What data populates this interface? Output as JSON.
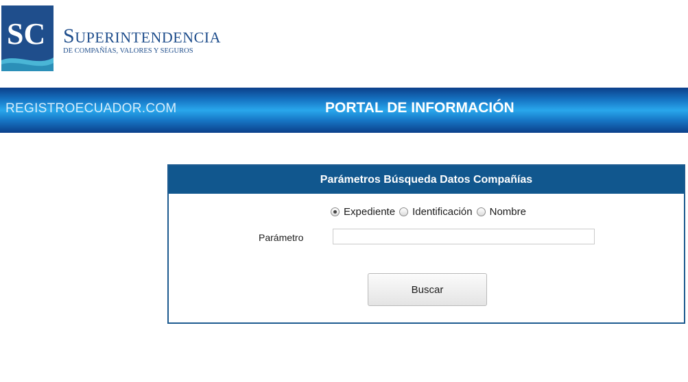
{
  "header": {
    "logo_mark": "SC",
    "logo_title_first": "S",
    "logo_title_rest": "UPERINTENDENCIA",
    "logo_subtitle": "DE COMPAÑÍAS, VALORES Y SEGUROS"
  },
  "banner": {
    "site_name": "REGISTROECUADOR.COM",
    "title": "PORTAL DE INFORMACIÓN"
  },
  "search_panel": {
    "title": "Parámetros Búsqueda Datos Compañías",
    "options": [
      {
        "label": "Expediente",
        "selected": true
      },
      {
        "label": "Identificación",
        "selected": false
      },
      {
        "label": "Nombre",
        "selected": false
      }
    ],
    "parameter_label": "Parámetro",
    "parameter_value": "",
    "search_button": "Buscar"
  },
  "colors": {
    "brand_blue": "#1f4e8c",
    "panel_header": "#11578e",
    "banner_light": "#29a7ec",
    "banner_dark": "#0b3f8a"
  }
}
